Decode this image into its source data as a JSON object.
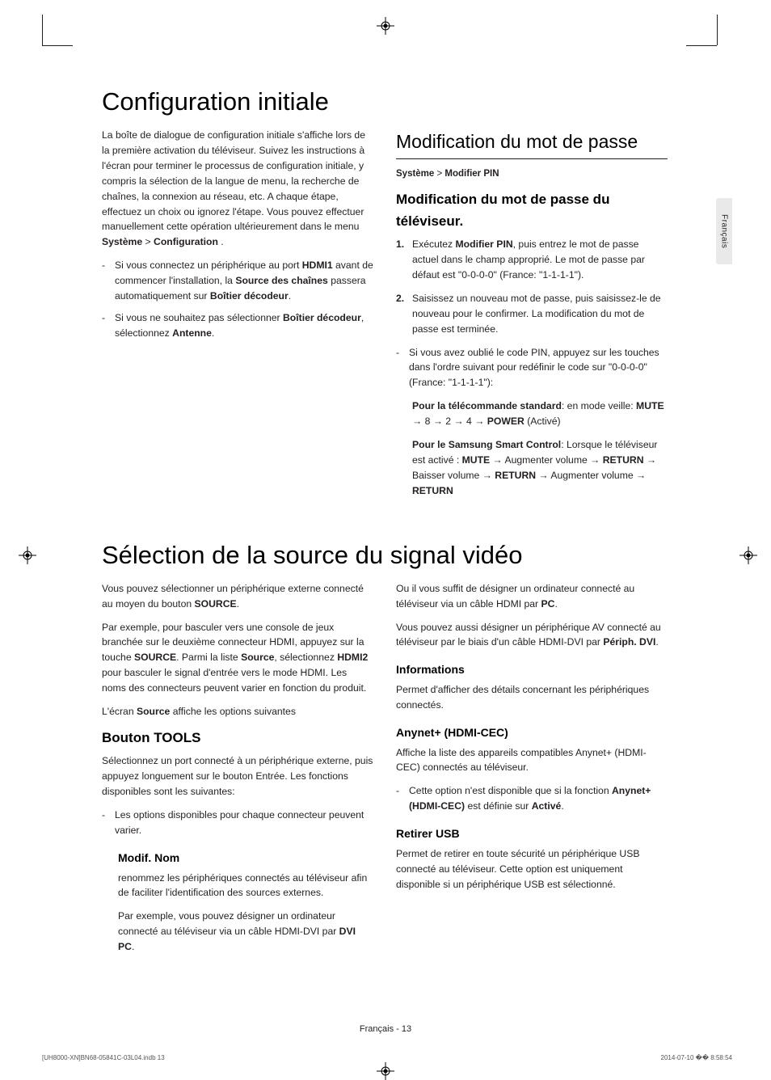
{
  "side_tab": "Français",
  "section1": {
    "title": "Configuration initiale",
    "left": {
      "intro_a": "La boîte de dialogue de configuration initiale s'affiche lors de la première activation du téléviseur. Suivez les instructions à l'écran pour terminer le processus de configuration initiale, y compris la sélection de la langue de menu, la recherche de chaînes, la connexion au réseau, etc. A chaque étape, effectuez un choix ou ignorez l'étape. Vous pouvez effectuer manuellement cette opération ultérieurement dans le menu ",
      "intro_bold1": "Système",
      "intro_gt": " > ",
      "intro_bold2": "Configuration",
      "intro_end": " .",
      "bullets": [
        {
          "pre": "Si vous connectez un périphérique au port ",
          "b1": "HDMI1",
          "mid1": " avant de commencer l'installation, la ",
          "b2": "Source des chaînes",
          "mid2": " passera automatiquement sur ",
          "b3": "Boîtier décodeur",
          "end": "."
        },
        {
          "pre": "Si vous ne souhaitez pas sélectionner ",
          "b1": "Boîtier décodeur",
          "mid1": ", sélectionnez ",
          "b2": "Antenne",
          "end": "."
        }
      ]
    },
    "right": {
      "h2": "Modification du mot de passe",
      "breadcrumb_a": "Système",
      "breadcrumb_gt": " > ",
      "breadcrumb_b": "Modifier PIN",
      "h3": "Modification du mot de passe du téléviseur.",
      "step1": {
        "num": "1.",
        "pre": "Exécutez ",
        "b1": "Modifier PIN",
        "rest": ", puis entrez le mot de passe actuel dans le champ approprié. Le mot de passe par défaut est \"0-0-0-0\" (France: \"1-1-1-1\")."
      },
      "step2": {
        "num": "2.",
        "text": "Saisissez un nouveau mot de passe, puis saisissez-le de nouveau pour le confirmer. La modification du mot de passe est terminée."
      },
      "dash1": "Si vous avez oublié le code PIN, appuyez sur les touches dans l'ordre suivant pour redéfinir le code sur \"0-0-0-0\" (France: \"1-1-1-1\"):",
      "para_std": {
        "b1": "Pour la télécommande standard",
        "after_b1": ": en mode veille: ",
        "b2": "MUTE",
        "arrows": " → 8 → 2 → 4 → ",
        "b3": "POWER",
        "end": " (Activé)"
      },
      "para_ssc": {
        "b1": "Pour le Samsung Smart Control",
        "after_b1": ": Lorsque le téléviseur est activé : ",
        "b2": "MUTE",
        "a1": " → Augmenter volume → ",
        "b3": "RETURN",
        "a2": " → Baisser volume → ",
        "b4": "RETURN",
        "a3": " → Augmenter volume → ",
        "b5": "RETURN"
      }
    }
  },
  "section2": {
    "title": "Sélection de la source du signal vidéo",
    "left": {
      "p1_a": "Vous pouvez sélectionner un périphérique externe connecté au moyen du bouton ",
      "p1_b": "SOURCE",
      "p1_c": ".",
      "p2_a": "Par exemple, pour basculer vers une console de jeux branchée sur le deuxième connecteur HDMI, appuyez sur la touche ",
      "p2_b1": "SOURCE",
      "p2_mid1": ". Parmi la liste ",
      "p2_b2": "Source",
      "p2_mid2": ", sélectionnez ",
      "p2_b3": "HDMI2",
      "p2_end": " pour basculer le signal d'entrée vers le mode HDMI. Les noms des connecteurs peuvent varier en fonction du produit.",
      "p3_a": "L'écran ",
      "p3_b": "Source",
      "p3_c": " affiche les options suivantes",
      "h3": "Bouton TOOLS",
      "p4": "Sélectionnez un port connecté à un périphérique externe, puis appuyez longuement sur le bouton Entrée. Les fonctions disponibles sont les suivantes:",
      "dash": "Les options disponibles pour chaque connecteur peuvent varier.",
      "h4": "Modif. Nom",
      "p5": "renommez les périphériques connectés au téléviseur afin de faciliter l'identification des sources externes.",
      "p6_a": "Par exemple, vous pouvez désigner un ordinateur connecté au téléviseur via un câble HDMI-DVI par ",
      "p6_b": "DVI PC",
      "p6_c": "."
    },
    "right": {
      "p1_a": "Ou il vous suffit de désigner un ordinateur connecté au téléviseur via un câble HDMI par ",
      "p1_b": "PC",
      "p1_c": ".",
      "p2_a": "Vous pouvez aussi désigner un périphérique AV connecté au téléviseur par le biais d'un câble HDMI-DVI par ",
      "p2_b": "Périph. DVI",
      "p2_c": ".",
      "h4a": "Informations",
      "p3": "Permet d'afficher des détails concernant les périphériques connectés.",
      "h4b": "Anynet+ (HDMI-CEC)",
      "p4": "Affiche la liste des appareils compatibles Anynet+ (HDMI-CEC) connectés au téléviseur.",
      "dash_a": "Cette option n'est disponible que si la fonction ",
      "dash_b": "Anynet+ (HDMI-CEC)",
      "dash_mid": " est définie sur ",
      "dash_b2": "Activé",
      "dash_end": ".",
      "h4c": "Retirer USB",
      "p5": "Permet de retirer en toute sécurité un périphérique USB connecté au téléviseur. Cette option est uniquement disponible si un périphérique USB est sélectionné."
    }
  },
  "footer": {
    "center": "Français - 13",
    "left": "[UH8000-XN]BN68-05841C-03L04.indb   13",
    "right": "2014-07-10   �� 8:58:54"
  }
}
